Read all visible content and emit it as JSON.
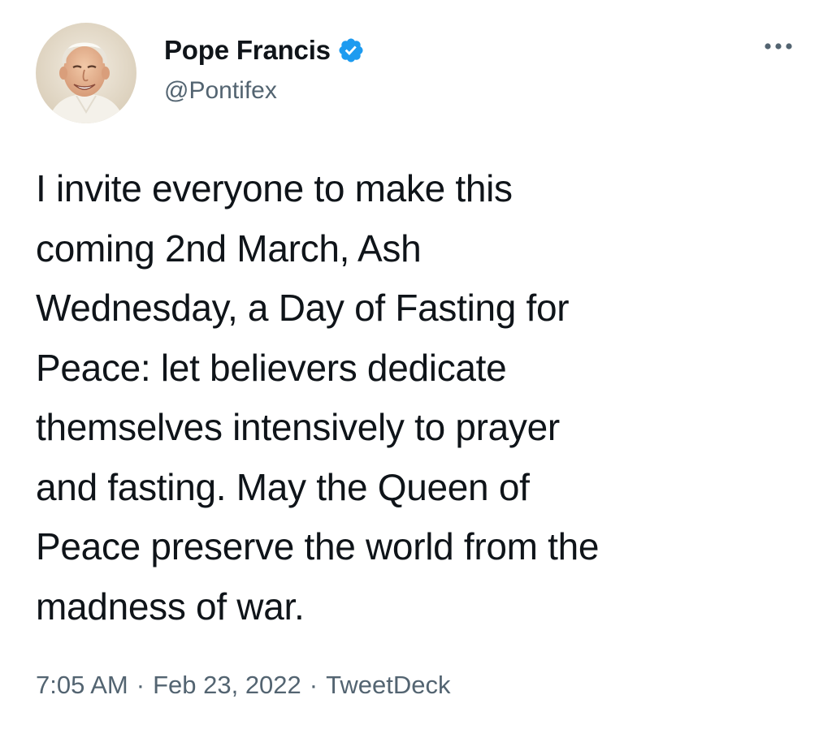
{
  "author": {
    "display_name": "Pope Francis",
    "handle": "@Pontifex",
    "verified": true,
    "avatar_icon": "pope-portrait-avatar"
  },
  "tweet": {
    "text_lines": [
      "I invite everyone to make this",
      "coming 2nd March, Ash",
      "Wednesday, a Day of Fasting for",
      "Peace: let believers dedicate",
      "themselves intensively to prayer",
      "and fasting. May the Queen of",
      "Peace preserve the world from the",
      "madness of war."
    ],
    "time": "7:05 AM",
    "date": "Feb 23, 2022",
    "source": "TweetDeck",
    "separator": "·"
  },
  "colors": {
    "text": "#0f1419",
    "secondary": "#536471",
    "verified": "#1d9bf0",
    "background": "#ffffff"
  }
}
